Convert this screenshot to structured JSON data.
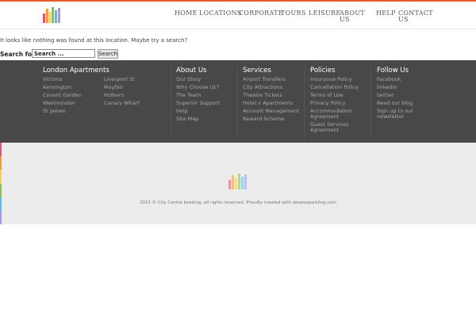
{
  "header": {
    "logo_name": "city-centre-booking-logo",
    "nav": [
      {
        "label": "HOME"
      },
      {
        "label": "LOCATIONS"
      },
      {
        "label": "CORPORATE"
      },
      {
        "label": "TOURS"
      },
      {
        "label": "LEISURE"
      },
      {
        "label": "ABOUT US"
      },
      {
        "label": "HELP"
      },
      {
        "label": "CONTACT US"
      }
    ]
  },
  "main": {
    "message": "It looks like nothing was found at this location. Maybe try a search?",
    "search": {
      "label": "Search for:",
      "value": "Search ...",
      "button": "Search"
    }
  },
  "footer": {
    "columns": [
      {
        "title": "London Apartments",
        "links": [
          "Victoria",
          "Kensington",
          "Covent Garden",
          "Westminster",
          "St james",
          "Liverpool St",
          "Mayfair",
          "Holborn",
          "Canary Wharf"
        ]
      },
      {
        "title": "About Us",
        "links": [
          "Our Story",
          "Why Choose Us?",
          "The Team",
          "Superior Support",
          "Help",
          "Site Map"
        ]
      },
      {
        "title": "Services",
        "links": [
          "Airport Transfers",
          "City Attractions",
          "Theatre Tickets",
          "Hotel v Apartments",
          "Account Management",
          "Reward Scheme"
        ]
      },
      {
        "title": "Policies",
        "links": [
          "Insurance Policy",
          "Cancellation Policy",
          "Terms of Use",
          "Privacy Policy",
          "Accommodation Agreement",
          "Guest Services Agreement"
        ]
      },
      {
        "title": "Follow Us",
        "links": [
          "Facebook",
          "linkedin",
          "twitter",
          "Read our blog",
          "Sign up to our newsletter"
        ]
      }
    ],
    "copyright": "2015 © City Centre booking, all rights reserved. Proudly created with wearesparkling.com"
  },
  "colors": {
    "accent": "#e35b2c",
    "footer_bg": "#484848",
    "bottom_bg": "#ececec",
    "logo_bars": [
      "#e94e77",
      "#f39c33",
      "#f7d54a",
      "#8cc152",
      "#4fc1e9",
      "#ac92ec",
      "#e94e77"
    ]
  }
}
